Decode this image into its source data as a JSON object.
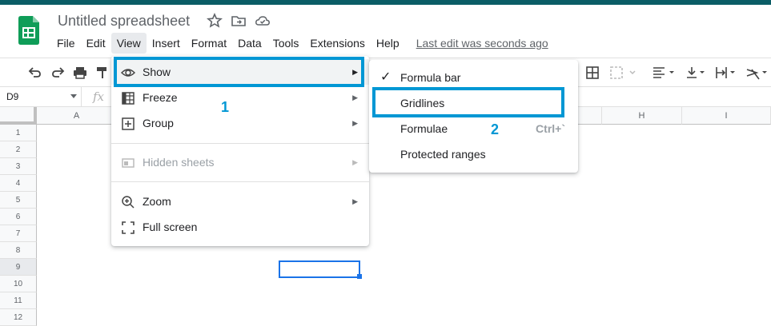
{
  "app": {
    "doc_title": "Untitled spreadsheet",
    "brand_color": "#0f9d58",
    "accent_color": "#1a73e8",
    "annotation_color": "#0097d4"
  },
  "menubar": {
    "items": [
      "File",
      "Edit",
      "View",
      "Insert",
      "Format",
      "Data",
      "Tools",
      "Extensions",
      "Help"
    ],
    "active": "View",
    "last_edit": "Last edit was seconds ago"
  },
  "namebox": {
    "value": "D9"
  },
  "formula": {
    "fx": "fx"
  },
  "grid": {
    "columns": [
      "A",
      "H",
      "I"
    ],
    "rows": [
      "1",
      "2",
      "3",
      "4",
      "5",
      "6",
      "7",
      "8",
      "9",
      "10",
      "11",
      "12"
    ],
    "selected_row": "9"
  },
  "view_menu": {
    "items": [
      {
        "label": "Show",
        "icon": "eye-icon"
      },
      {
        "label": "Freeze",
        "icon": "freeze-icon"
      },
      {
        "label": "Group",
        "icon": "group-icon"
      },
      {
        "label": "Hidden sheets",
        "icon": "hidden-sheets-icon"
      },
      {
        "label": "Zoom",
        "icon": "zoom-icon"
      },
      {
        "label": "Full screen",
        "icon": "fullscreen-icon"
      }
    ]
  },
  "show_submenu": {
    "items": [
      {
        "label": "Formula bar",
        "checked": true
      },
      {
        "label": "Gridlines"
      },
      {
        "label": "Formulae",
        "shortcut": "Ctrl+`"
      },
      {
        "label": "Protected ranges"
      }
    ]
  },
  "annotations": {
    "one": "1",
    "two": "2"
  }
}
